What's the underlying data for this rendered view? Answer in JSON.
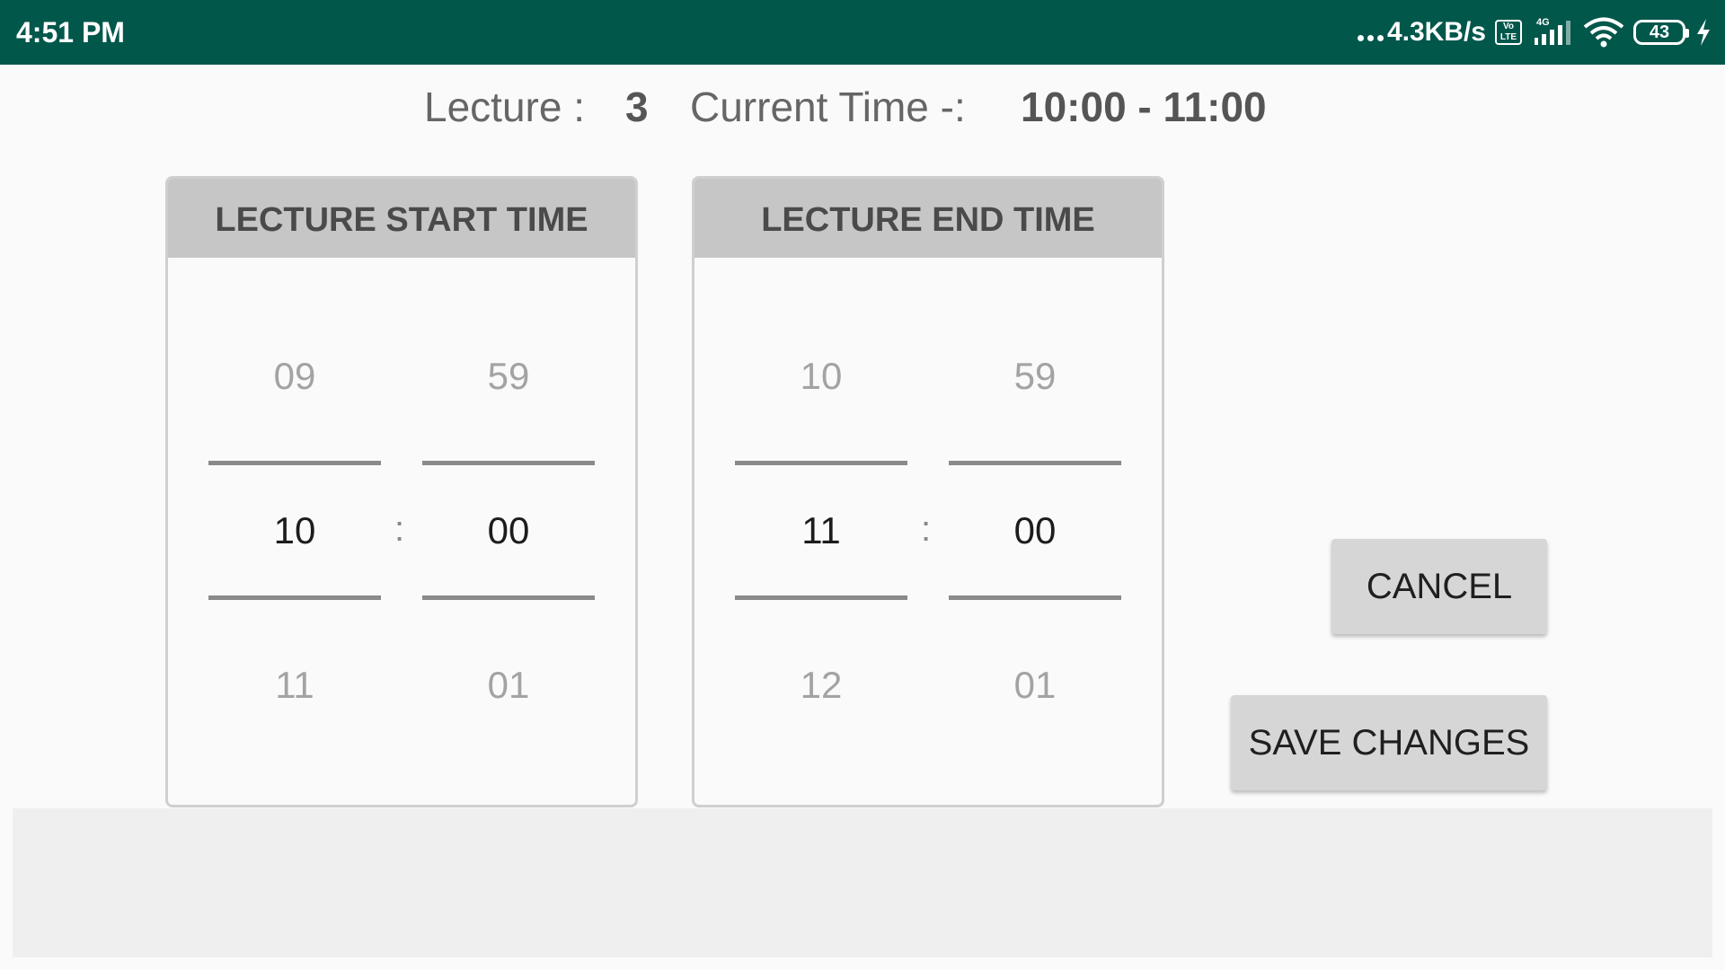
{
  "status_bar": {
    "time": "4:51 PM",
    "net_speed": "4.3KB/s",
    "volte": "Vo LTE",
    "network_type": "4G",
    "battery_level": "43",
    "icons": [
      "dots-icon",
      "volte-icon",
      "signal-icon",
      "wifi-icon",
      "battery-icon",
      "charging-bolt-icon"
    ]
  },
  "header": {
    "lecture_label": "Lecture :",
    "lecture_number": "3",
    "current_time_label": "Current Time -:",
    "current_time_range": "10:00 - 11:00"
  },
  "start_panel": {
    "title": "LECTURE START TIME",
    "hours": {
      "prev": "09",
      "selected": "10",
      "next": "11"
    },
    "separator": ":",
    "minutes": {
      "prev": "59",
      "selected": "00",
      "next": "01"
    }
  },
  "end_panel": {
    "title": "LECTURE END TIME",
    "hours": {
      "prev": "10",
      "selected": "11",
      "next": "12"
    },
    "separator": ":",
    "minutes": {
      "prev": "59",
      "selected": "00",
      "next": "01"
    }
  },
  "buttons": {
    "cancel": "CANCEL",
    "save": "SAVE CHANGES"
  },
  "colors": {
    "status_bar": "#02574b",
    "panel_header": "#c6c6c6",
    "button": "#d6d6d6",
    "background": "#fafafa"
  }
}
